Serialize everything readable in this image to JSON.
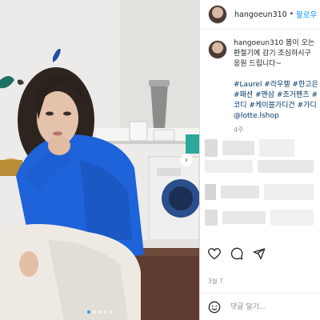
{
  "post": {
    "username": "hangoeun310",
    "follow_label": "팔로우",
    "separator": "•",
    "caption_lines": [
      "봄이 오는",
      "환절기에 감기 조심하시구",
      "응원 드립니다~"
    ],
    "hashtag_lines": [
      "#Laurel #라우렐 #한고은",
      "#패션 #맨삼 #조거팬츠 #",
      "코디 #케이블가디건 #가디",
      "@lotte.lshop"
    ],
    "age": "4주",
    "likes_date": "3월 7",
    "comment_placeholder": "댓글 달기..."
  },
  "carousel": {
    "next_glyph": "›",
    "dot_count": 5,
    "active_dot": 0
  },
  "colors": {
    "link_blue": "#0095f6",
    "hashtag": "#00376b",
    "sweater_blue": "#1e63d9"
  }
}
